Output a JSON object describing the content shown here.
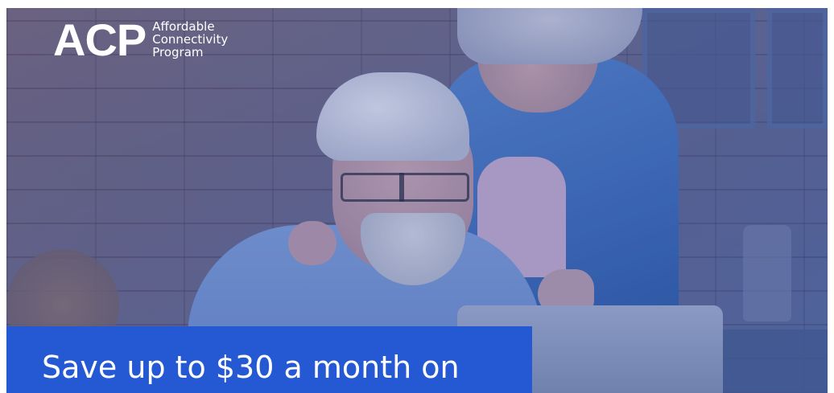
{
  "logo": {
    "acronym": "ACP",
    "line1": "Affordable",
    "line2": "Connectivity",
    "line3": "Program"
  },
  "banner": {
    "headline": "Save up to $30 a month on"
  },
  "colors": {
    "banner": "#2559d3",
    "text": "#ffffff"
  }
}
